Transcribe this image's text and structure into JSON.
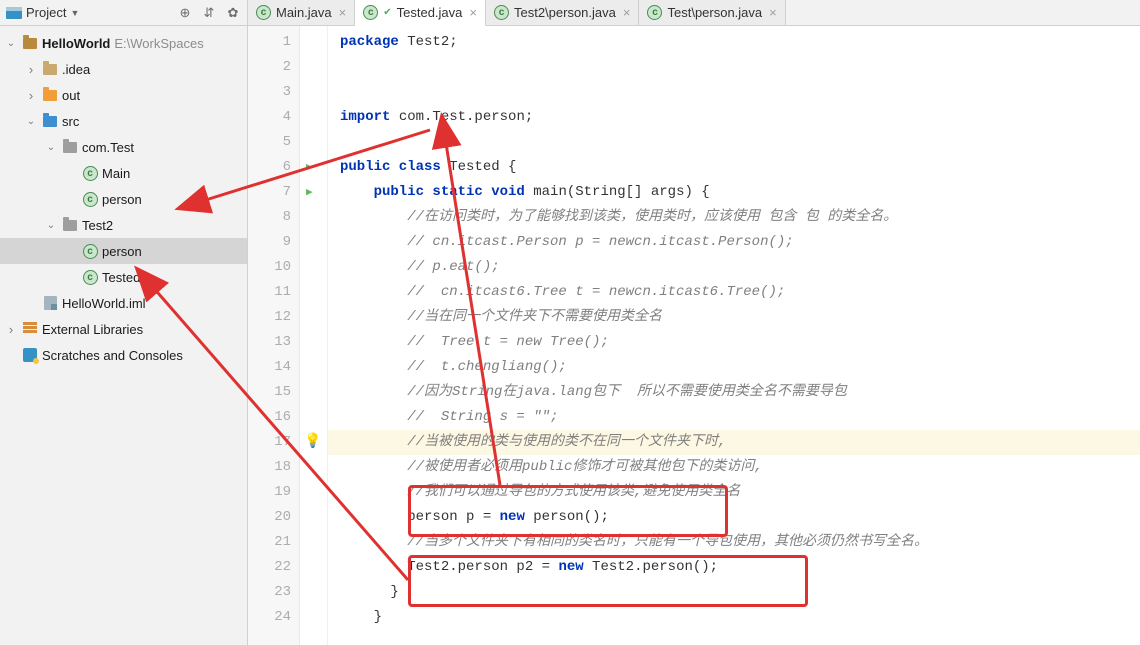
{
  "sidebar": {
    "header": {
      "label": "Project"
    },
    "tree": {
      "root": {
        "label": "HelloWorld",
        "path": "E:\\WorkSpaces"
      },
      "idea": {
        "label": ".idea"
      },
      "out": {
        "label": "out"
      },
      "src": {
        "label": "src"
      },
      "comTest": {
        "label": "com.Test"
      },
      "main": {
        "label": "Main"
      },
      "person1": {
        "label": "person"
      },
      "test2": {
        "label": "Test2"
      },
      "person2": {
        "label": "person"
      },
      "tested": {
        "label": "Tested"
      },
      "iml": {
        "label": "HelloWorld.iml"
      },
      "extlib": {
        "label": "External Libraries"
      },
      "scratch": {
        "label": "Scratches and Consoles"
      }
    }
  },
  "tabs": {
    "t1": "Main.java",
    "t2": "Tested.java",
    "t3": "Test2\\person.java",
    "t4": "Test\\person.java"
  },
  "gutter": [
    "1",
    "2",
    "3",
    "4",
    "5",
    "6",
    "7",
    "8",
    "9",
    "10",
    "11",
    "12",
    "13",
    "14",
    "15",
    "16",
    "17",
    "18",
    "19",
    "20",
    "21",
    "22",
    "23",
    "24"
  ],
  "code": {
    "l1a": "package",
    "l1b": " Test2;",
    "l4a": "import",
    "l4b": " com.Test.person;",
    "l6a": "public class",
    "l6b": " Tested {",
    "l7a": "    public static void",
    "l7b": " main(String[] args) {",
    "l8": "        //在访问类时，为了能够找到该类，使用类时，应该使用 包含 包 的类全名。",
    "l9": "        // cn.itcast.Person p = newcn.itcast.Person();",
    "l10": "        // p.eat();",
    "l11": "        //  cn.itcast6.Tree t = newcn.itcast6.Tree();",
    "l12": "        //当在同一个文件夹下不需要使用类全名",
    "l13": "        //  Tree t = new Tree();",
    "l14": "        //  t.chengliang();",
    "l15": "        //因为String在java.lang包下  所以不需要使用类全名不需要导包",
    "l16": "        //  String s = \"\";",
    "l17": "        //当被使用的类与使用的类不在同一个文件夹下时,",
    "l18": "        //被使用者必须用public修饰才可被其他包下的类访问,",
    "l19": "        //我们可以通过导包的方式使用该类,避免使用类全名",
    "l20a": "        person p = ",
    "l20b": "new",
    "l20c": " person();",
    "l21": "        //当多个文件夹下有相同的类名时，只能有一个导包使用，其他必须仍然书写全名。",
    "l22a": "        Test2.person p2 = ",
    "l22b": "new",
    "l22c": " Test2.person();",
    "l23": "      }",
    "l24": "    }"
  }
}
